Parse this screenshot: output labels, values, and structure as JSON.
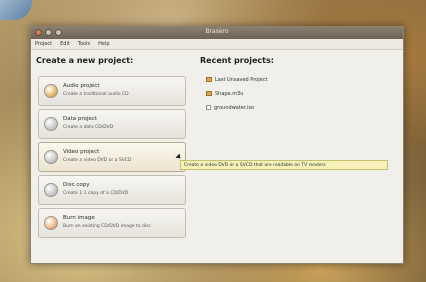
{
  "window": {
    "title": "Brasero"
  },
  "menu": [
    "Project",
    "Edit",
    "Tools",
    "Help"
  ],
  "left_heading": "Create a new project:",
  "right_heading": "Recent projects:",
  "projects": [
    {
      "title": "Audio project",
      "desc": "Create a traditional audio CD",
      "icon": "audio-disc-icon"
    },
    {
      "title": "Data project",
      "desc": "Create a data CD/DVD",
      "icon": "data-disc-icon"
    },
    {
      "title": "Video project",
      "desc": "Create a video DVD or a SVCD",
      "icon": "video-disc-icon"
    },
    {
      "title": "Disc copy",
      "desc": "Create 1:1 copy of a CD/DVD",
      "icon": "copy-disc-icon"
    },
    {
      "title": "Burn image",
      "desc": "Burn an existing CD/DVD image to disc",
      "icon": "burn-image-icon"
    }
  ],
  "recent": [
    {
      "label": "Last Unsaved Project",
      "icon": "folder-icon"
    },
    {
      "label": "Shape.m3u",
      "icon": "folder-icon"
    },
    {
      "label": "groundwater.iso",
      "icon": "document-icon"
    }
  ],
  "tooltip": "Create a video DVD or a SVCD that are readable on TV readers",
  "colors": {
    "tooltip_bg": "#f5f1b8",
    "window_bg": "#f1efe9"
  }
}
